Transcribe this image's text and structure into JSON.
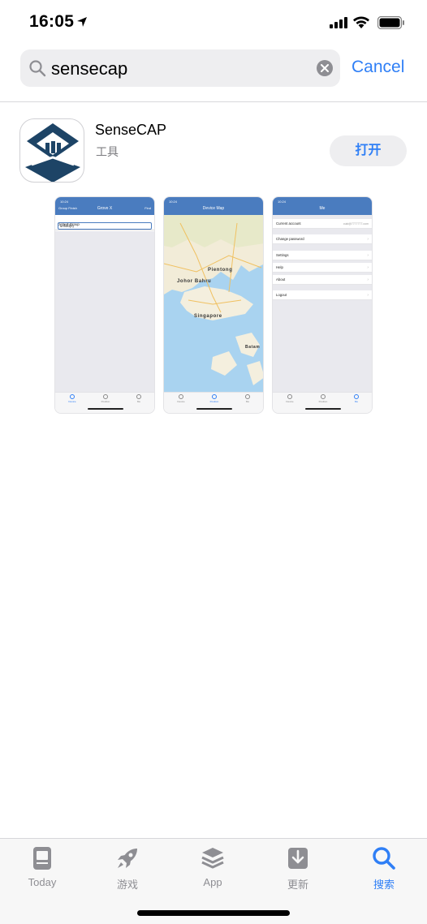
{
  "status_bar": {
    "time": "16:05"
  },
  "search": {
    "query": "sensecap",
    "cancel_label": "Cancel"
  },
  "result": {
    "app_name": "SenseCAP",
    "category": "工具",
    "open_label": "打开",
    "screenshots": [
      {
        "time": "10:24",
        "title": "Grove X",
        "left_sub": "Group  Finish",
        "right_sub": "Find",
        "row_label": "Default Group",
        "row_button": "unfold(0)",
        "tabs": [
          "Device",
          "Position",
          "Me"
        ],
        "active_tab": 0
      },
      {
        "time": "10:24",
        "title": "Device Map",
        "map_labels": {
          "pientong": "Pientong",
          "johor": "Johor Bahru",
          "singapore": "Singapore",
          "batam": "Batam"
        },
        "tabs": [
          "Device",
          "Position",
          "Me"
        ],
        "active_tab": 1
      },
      {
        "time": "10:24",
        "title": "Me",
        "rows": [
          {
            "label": "Current account",
            "value": "cuid@7777777.com"
          },
          {
            "label": "Change password"
          },
          {
            "label": "Settings"
          },
          {
            "label": "Help"
          },
          {
            "label": "About"
          },
          {
            "label": "Logout"
          }
        ],
        "tabs": [
          "Device",
          "Position",
          "Me"
        ],
        "active_tab": 2
      }
    ]
  },
  "tab_bar": {
    "items": [
      {
        "label": "Today",
        "icon": "today-icon"
      },
      {
        "label": "游戏",
        "icon": "rocket-icon"
      },
      {
        "label": "App",
        "icon": "apps-stack-icon"
      },
      {
        "label": "更新",
        "icon": "download-icon"
      },
      {
        "label": "搜索",
        "icon": "search-icon"
      }
    ],
    "active_index": 4
  },
  "colors": {
    "accent": "#2f7ff6",
    "app_header": "#4a7cbf",
    "icon_navy": "#1d4466"
  }
}
